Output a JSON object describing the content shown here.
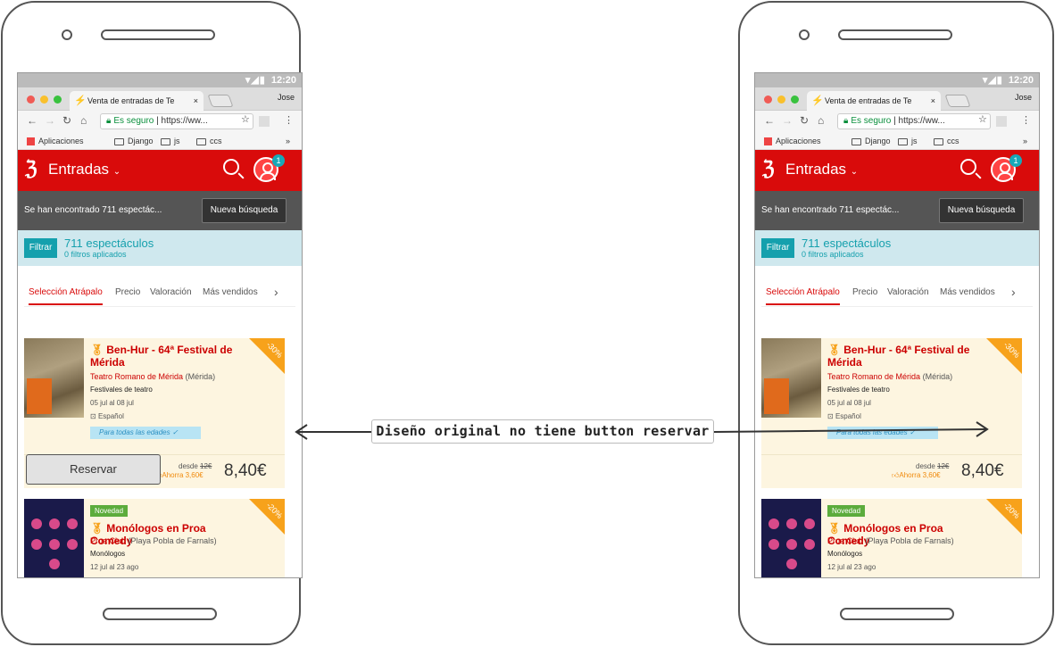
{
  "status": {
    "time": "12:20"
  },
  "browser": {
    "tab_title": "Venta de entradas de Te",
    "user": "Jose",
    "secure_label": "Es seguro",
    "url": "https://ww...",
    "bookmarks": [
      "Aplicaciones",
      "Django",
      "js",
      "ccs"
    ],
    "more": "»"
  },
  "header": {
    "brand": "Entradas",
    "notifications": "1"
  },
  "results": {
    "text": "Se han encontrado 711 espectác...",
    "new_search": "Nueva búsqueda"
  },
  "filter": {
    "button": "Filtrar",
    "count": "711 espectáculos",
    "applied": "0 filtros aplicados"
  },
  "sort": {
    "items": [
      "Selección Atrápalo",
      "Precio",
      "Valoración",
      "Más vendidos"
    ]
  },
  "cards": [
    {
      "title": "Ben-Hur - 64ª Festival de Mérida",
      "venue": "Teatro Romano de Mérida",
      "city": "(Mérida)",
      "category": "Festivales de teatro",
      "dates": "05 jul al 08 jul",
      "language": "Español",
      "ages": "Para todas las edades",
      "discount": "-30%",
      "from_label": "desde",
      "old_price": "12€",
      "savings": "Ahorra 3,60€",
      "price": "8,40€"
    },
    {
      "tag": "Novedad",
      "title": "Monólogos en Proa Comedy",
      "venue": "Proa Club",
      "city": "(Playa Pobla de Farnals)",
      "category": "Monólogos",
      "dates": "12 jul al 23 ago",
      "discount": "-20%"
    }
  ],
  "reservar_button": "Reservar",
  "annotation": "Diseño original no tiene button reservar",
  "colors": {
    "brand_red": "#d90b0b",
    "teal": "#15a0ad",
    "orange": "#f7a21b"
  }
}
